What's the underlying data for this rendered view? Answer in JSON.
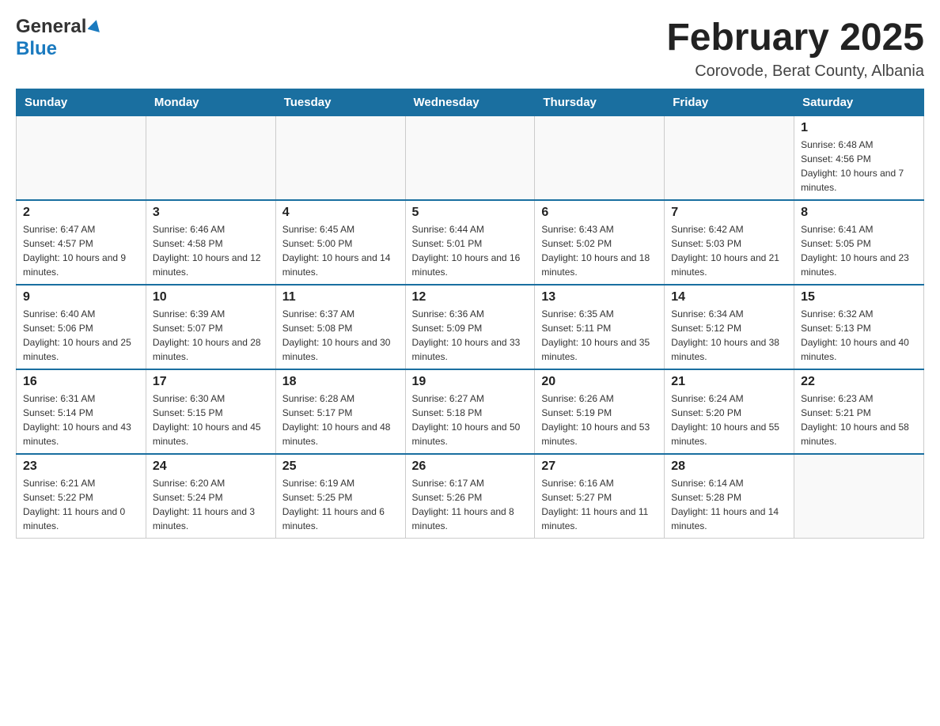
{
  "header": {
    "logo_general": "General",
    "logo_blue": "Blue",
    "month_title": "February 2025",
    "location": "Corovode, Berat County, Albania"
  },
  "weekdays": [
    "Sunday",
    "Monday",
    "Tuesday",
    "Wednesday",
    "Thursday",
    "Friday",
    "Saturday"
  ],
  "weeks": [
    [
      {
        "day": "",
        "info": ""
      },
      {
        "day": "",
        "info": ""
      },
      {
        "day": "",
        "info": ""
      },
      {
        "day": "",
        "info": ""
      },
      {
        "day": "",
        "info": ""
      },
      {
        "day": "",
        "info": ""
      },
      {
        "day": "1",
        "info": "Sunrise: 6:48 AM\nSunset: 4:56 PM\nDaylight: 10 hours and 7 minutes."
      }
    ],
    [
      {
        "day": "2",
        "info": "Sunrise: 6:47 AM\nSunset: 4:57 PM\nDaylight: 10 hours and 9 minutes."
      },
      {
        "day": "3",
        "info": "Sunrise: 6:46 AM\nSunset: 4:58 PM\nDaylight: 10 hours and 12 minutes."
      },
      {
        "day": "4",
        "info": "Sunrise: 6:45 AM\nSunset: 5:00 PM\nDaylight: 10 hours and 14 minutes."
      },
      {
        "day": "5",
        "info": "Sunrise: 6:44 AM\nSunset: 5:01 PM\nDaylight: 10 hours and 16 minutes."
      },
      {
        "day": "6",
        "info": "Sunrise: 6:43 AM\nSunset: 5:02 PM\nDaylight: 10 hours and 18 minutes."
      },
      {
        "day": "7",
        "info": "Sunrise: 6:42 AM\nSunset: 5:03 PM\nDaylight: 10 hours and 21 minutes."
      },
      {
        "day": "8",
        "info": "Sunrise: 6:41 AM\nSunset: 5:05 PM\nDaylight: 10 hours and 23 minutes."
      }
    ],
    [
      {
        "day": "9",
        "info": "Sunrise: 6:40 AM\nSunset: 5:06 PM\nDaylight: 10 hours and 25 minutes."
      },
      {
        "day": "10",
        "info": "Sunrise: 6:39 AM\nSunset: 5:07 PM\nDaylight: 10 hours and 28 minutes."
      },
      {
        "day": "11",
        "info": "Sunrise: 6:37 AM\nSunset: 5:08 PM\nDaylight: 10 hours and 30 minutes."
      },
      {
        "day": "12",
        "info": "Sunrise: 6:36 AM\nSunset: 5:09 PM\nDaylight: 10 hours and 33 minutes."
      },
      {
        "day": "13",
        "info": "Sunrise: 6:35 AM\nSunset: 5:11 PM\nDaylight: 10 hours and 35 minutes."
      },
      {
        "day": "14",
        "info": "Sunrise: 6:34 AM\nSunset: 5:12 PM\nDaylight: 10 hours and 38 minutes."
      },
      {
        "day": "15",
        "info": "Sunrise: 6:32 AM\nSunset: 5:13 PM\nDaylight: 10 hours and 40 minutes."
      }
    ],
    [
      {
        "day": "16",
        "info": "Sunrise: 6:31 AM\nSunset: 5:14 PM\nDaylight: 10 hours and 43 minutes."
      },
      {
        "day": "17",
        "info": "Sunrise: 6:30 AM\nSunset: 5:15 PM\nDaylight: 10 hours and 45 minutes."
      },
      {
        "day": "18",
        "info": "Sunrise: 6:28 AM\nSunset: 5:17 PM\nDaylight: 10 hours and 48 minutes."
      },
      {
        "day": "19",
        "info": "Sunrise: 6:27 AM\nSunset: 5:18 PM\nDaylight: 10 hours and 50 minutes."
      },
      {
        "day": "20",
        "info": "Sunrise: 6:26 AM\nSunset: 5:19 PM\nDaylight: 10 hours and 53 minutes."
      },
      {
        "day": "21",
        "info": "Sunrise: 6:24 AM\nSunset: 5:20 PM\nDaylight: 10 hours and 55 minutes."
      },
      {
        "day": "22",
        "info": "Sunrise: 6:23 AM\nSunset: 5:21 PM\nDaylight: 10 hours and 58 minutes."
      }
    ],
    [
      {
        "day": "23",
        "info": "Sunrise: 6:21 AM\nSunset: 5:22 PM\nDaylight: 11 hours and 0 minutes."
      },
      {
        "day": "24",
        "info": "Sunrise: 6:20 AM\nSunset: 5:24 PM\nDaylight: 11 hours and 3 minutes."
      },
      {
        "day": "25",
        "info": "Sunrise: 6:19 AM\nSunset: 5:25 PM\nDaylight: 11 hours and 6 minutes."
      },
      {
        "day": "26",
        "info": "Sunrise: 6:17 AM\nSunset: 5:26 PM\nDaylight: 11 hours and 8 minutes."
      },
      {
        "day": "27",
        "info": "Sunrise: 6:16 AM\nSunset: 5:27 PM\nDaylight: 11 hours and 11 minutes."
      },
      {
        "day": "28",
        "info": "Sunrise: 6:14 AM\nSunset: 5:28 PM\nDaylight: 11 hours and 14 minutes."
      },
      {
        "day": "",
        "info": ""
      }
    ]
  ]
}
